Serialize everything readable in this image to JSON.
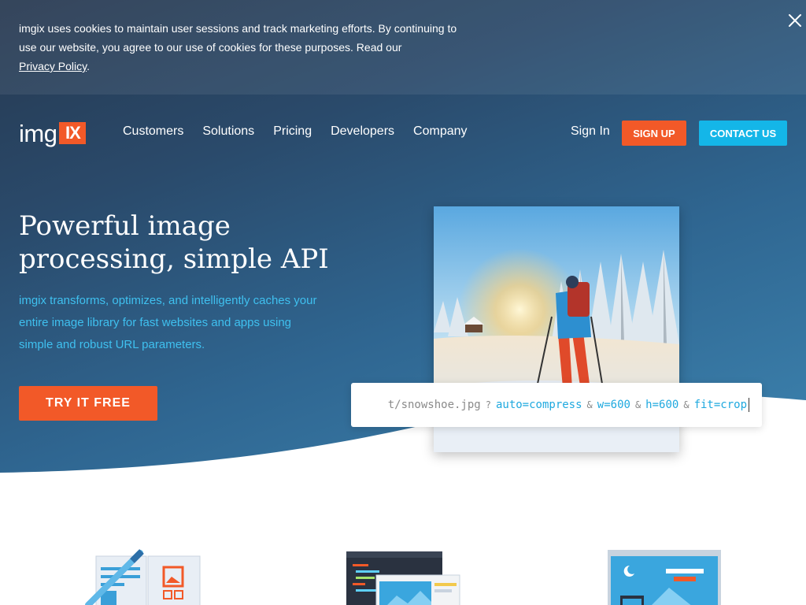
{
  "cookie_banner": {
    "text": "imgix uses cookies to maintain user sessions and track marketing efforts. By continuing to use our website, you agree to our use of cookies for these purposes. Read our",
    "link_label": "Privacy Policy",
    "trailing": ".",
    "close_icon": "close-icon"
  },
  "logo": {
    "text": "img",
    "badge": "IX"
  },
  "nav": {
    "links": [
      "Customers",
      "Solutions",
      "Pricing",
      "Developers",
      "Company"
    ],
    "sign_in": "Sign In",
    "sign_up": "SIGN UP",
    "contact": "CONTACT US"
  },
  "hero": {
    "title": "Powerful image processing, simple API",
    "subtitle": "imgix transforms, optimizes, and intelligently caches your entire image library for fast websites and apps using simple and robust URL parameters.",
    "cta": "TRY IT FREE"
  },
  "url_demo": {
    "path": "t/snowshoe.jpg",
    "query_sep": "?",
    "amp": "&",
    "params": [
      "auto=compress",
      "w=600",
      "h=600",
      "fit=crop"
    ]
  },
  "colors": {
    "accent_orange": "#f25928",
    "accent_blue": "#14b6e8",
    "subtitle_blue": "#3fc0ef"
  },
  "features": {
    "icons": [
      "design-tool-icon",
      "code-editor-icon",
      "browser-image-icon"
    ]
  }
}
